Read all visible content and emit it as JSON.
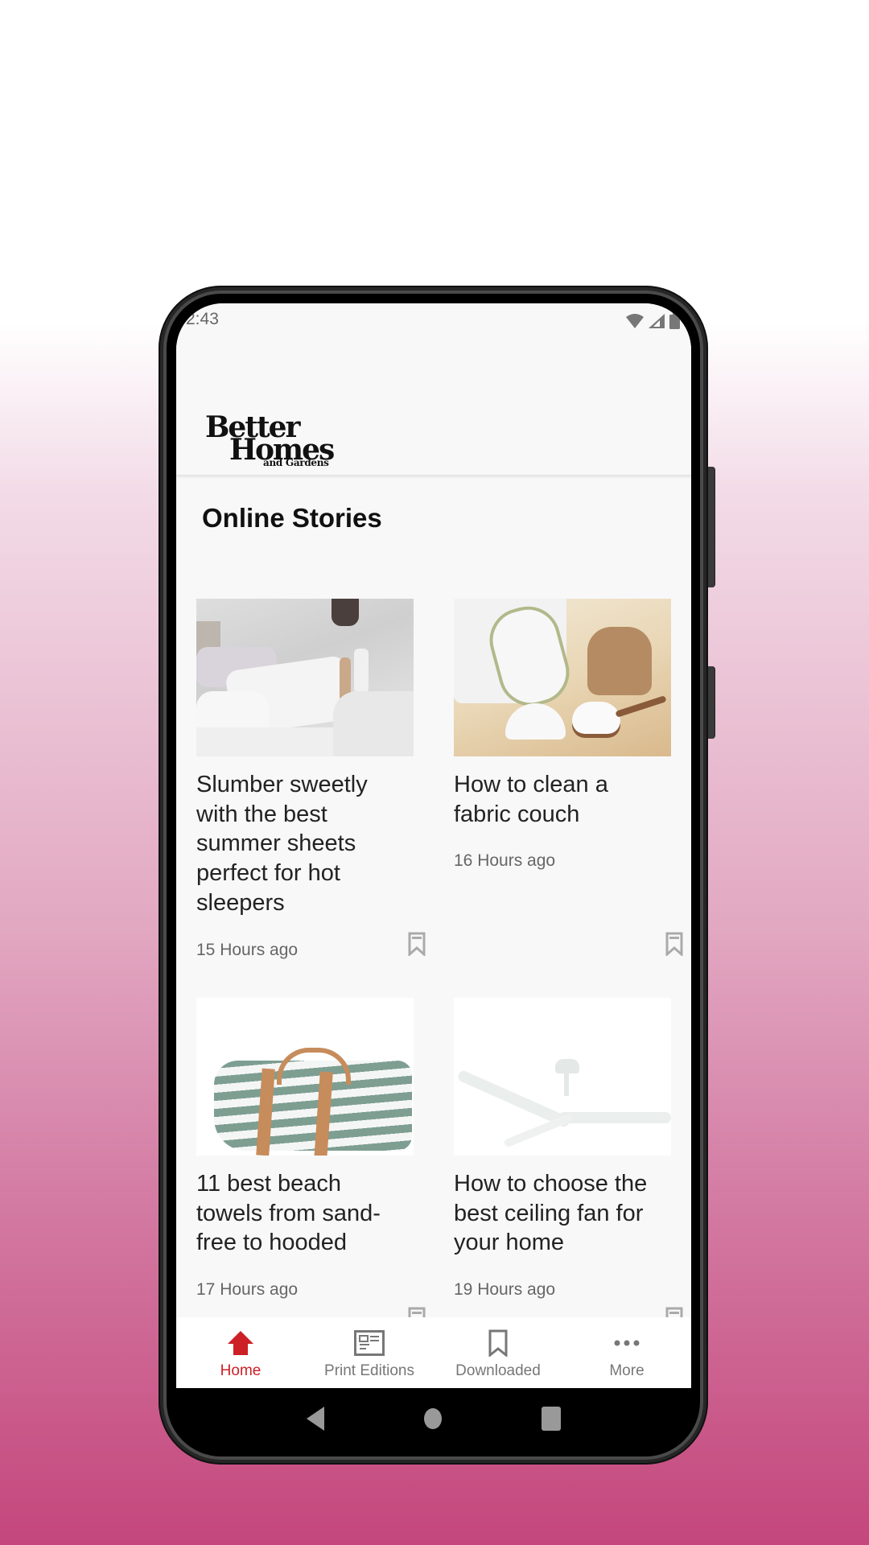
{
  "status_bar": {
    "time": "2:43",
    "icons": [
      "wifi-icon",
      "signal-icon",
      "battery-icon"
    ]
  },
  "header": {
    "logo": {
      "line1": "Better",
      "line2": "Homes",
      "line3": "and Gardens"
    }
  },
  "main": {
    "section_title": "Online Stories",
    "stories": [
      {
        "title": "Slumber sweetly with the best summer sheets perfect for hot sleepers",
        "time": "15 Hours ago",
        "image": "bed with white pillows and sheets",
        "bookmark_icon": "bookmark-icon"
      },
      {
        "title": "How to clean a fabric couch",
        "time": "16 Hours ago",
        "image": "baking soda jar with cork lid and wooden spoon",
        "bookmark_icon": "bookmark-icon"
      },
      {
        "title": "11 best beach towels from sand-free to hooded",
        "time": "17 Hours ago",
        "image": "rolled striped beach towel with leather strap",
        "bookmark_icon": "bookmark-icon"
      },
      {
        "title": "How to choose the best ceiling fan for your home",
        "time": "19 Hours ago",
        "image": "white ceiling fan",
        "bookmark_icon": "bookmark-icon"
      }
    ]
  },
  "bottom_nav": {
    "items": [
      {
        "label": "Home",
        "icon": "home-icon",
        "active": true
      },
      {
        "label": "Print Editions",
        "icon": "newspaper-icon",
        "active": false
      },
      {
        "label": "Downloaded",
        "icon": "bookmark-icon",
        "active": false
      },
      {
        "label": "More",
        "icon": "more-dots-icon",
        "active": false
      }
    ]
  },
  "colors": {
    "accent": "#cc1f26",
    "nav_inactive": "#777777",
    "background_bottom": "#c4467c"
  }
}
